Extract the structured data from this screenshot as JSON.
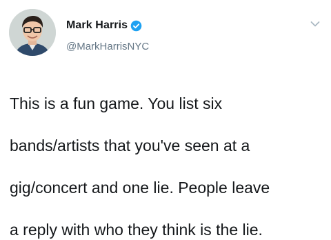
{
  "user": {
    "display_name": "Mark Harris",
    "handle": "@MarkHarrisNYC",
    "verified": true,
    "avatar_icon": "profile-photo"
  },
  "tweet": {
    "text_lines": [
      "This is a fun game. You list six",
      "bands/artists that you've seen at a",
      "gig/concert and one lie. People leave",
      "a reply with who they think is the lie."
    ]
  },
  "colors": {
    "text": "#14171a",
    "secondary": "#657786",
    "verified": "#1da1f2",
    "caret": "#aab8c2"
  }
}
